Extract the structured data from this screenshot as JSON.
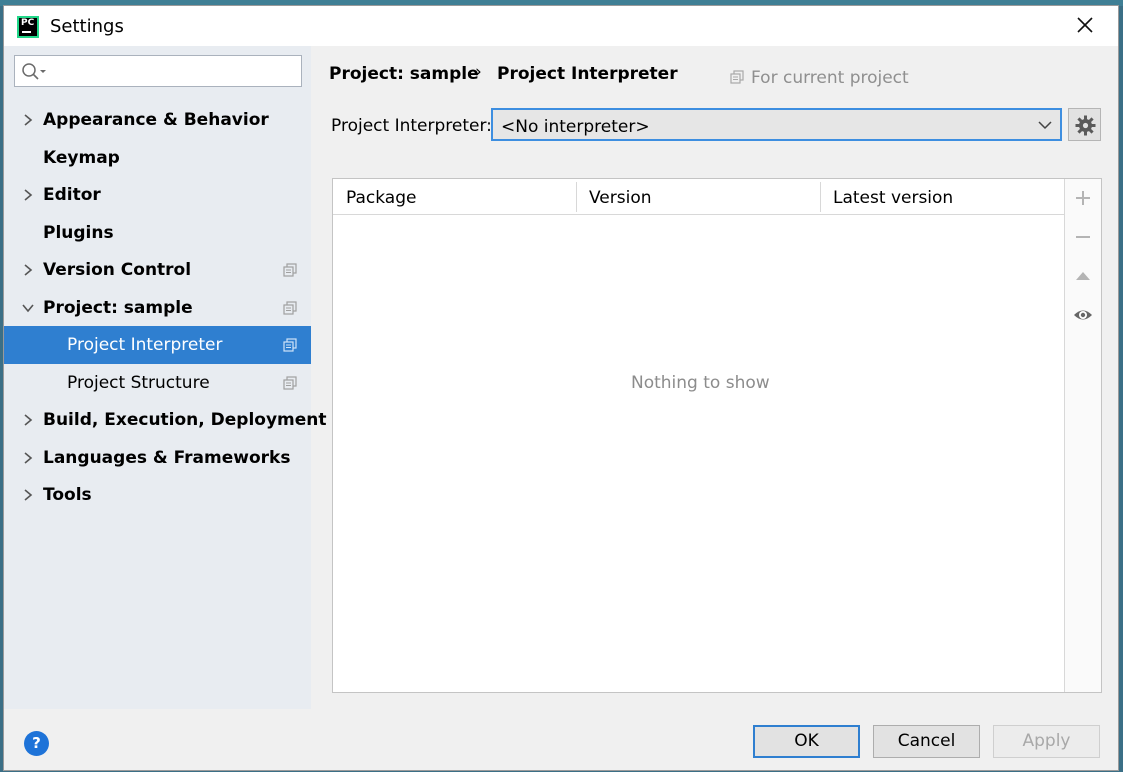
{
  "window": {
    "title": "Settings",
    "app_icon_text": "PC"
  },
  "search": {
    "placeholder": "",
    "value": ""
  },
  "sidebar": {
    "items": [
      {
        "label": "Appearance & Behavior",
        "chevron": "right",
        "project_icon": false
      },
      {
        "label": "Keymap",
        "chevron": "none",
        "project_icon": false
      },
      {
        "label": "Editor",
        "chevron": "right",
        "project_icon": false
      },
      {
        "label": "Plugins",
        "chevron": "none",
        "project_icon": false
      },
      {
        "label": "Version Control",
        "chevron": "right",
        "project_icon": true
      },
      {
        "label": "Project: sample",
        "chevron": "down",
        "project_icon": true
      },
      {
        "label": "Project Interpreter",
        "chevron": "none",
        "project_icon": true,
        "selected": true,
        "child": true
      },
      {
        "label": "Project Structure",
        "chevron": "none",
        "project_icon": true,
        "child": true
      },
      {
        "label": "Build, Execution, Deployment",
        "chevron": "right",
        "project_icon": false
      },
      {
        "label": "Languages & Frameworks",
        "chevron": "right",
        "project_icon": false
      },
      {
        "label": "Tools",
        "chevron": "right",
        "project_icon": false
      }
    ]
  },
  "breadcrumb": {
    "parent": "Project: sample",
    "separator": "›",
    "current": "Project Interpreter"
  },
  "scope_hint": "For current project",
  "interpreter": {
    "label": "Project Interpreter:",
    "value": "<No interpreter>"
  },
  "packages_table": {
    "columns": [
      "Package",
      "Version",
      "Latest version"
    ],
    "rows": [],
    "empty_text": "Nothing to show"
  },
  "table_tools": [
    "add-icon",
    "remove-icon",
    "upgrade-icon",
    "show-early-releases-icon"
  ],
  "footer": {
    "help": "?",
    "ok": "OK",
    "cancel": "Cancel",
    "apply": "Apply"
  },
  "colors": {
    "accent": "#2f7fd0",
    "sidebar_bg": "#e8ecf1",
    "dialog_bg": "#f0f0f0"
  }
}
